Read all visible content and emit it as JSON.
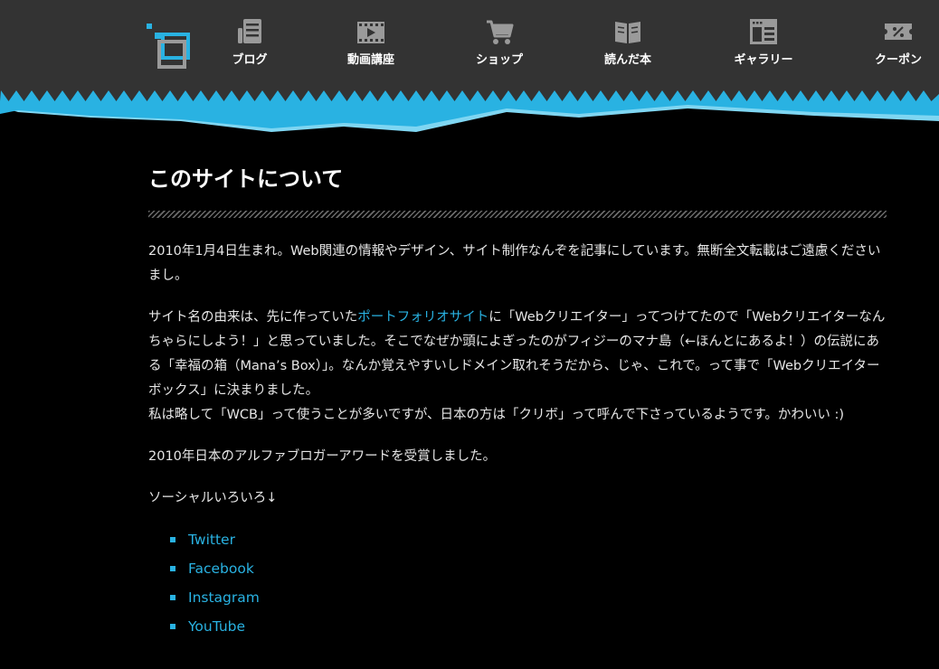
{
  "colors": {
    "header_bg": "#333333",
    "accent": "#29b2e2",
    "accent_light": "#7fd6f2",
    "text": "#e6e6e6",
    "background": "#000000"
  },
  "logo": {
    "icon": "site-logo-icon"
  },
  "nav": [
    {
      "label": "ブログ",
      "icon": "notepad-icon"
    },
    {
      "label": "動画講座",
      "icon": "film-icon"
    },
    {
      "label": "ショップ",
      "icon": "shopping-cart-icon"
    },
    {
      "label": "読んだ本",
      "icon": "open-book-icon"
    },
    {
      "label": "ギャラリー",
      "icon": "browser-window-icon"
    },
    {
      "label": "クーポン",
      "icon": "coupon-ticket-icon"
    }
  ],
  "page": {
    "title": "このサイトについて",
    "p1": "2010年1月4日生まれ。Web関連の情報やデザイン、サイト制作なんぞを記事にしています。無断全文転載はご遠慮くださいまし。",
    "p2_before": "サイト名の由来は、先に作っていた",
    "p2_link": "ポートフォリオサイト",
    "p2_after": "に「Webクリエイター」ってつけてたので「Webクリエイターなんちゃらにしよう！」と思っていました。そこでなぜか頭によぎったのがフィジーのマナ島（←ほんとにあるよ！）の伝説にある「幸福の箱（Mana’s Box）」。なんか覚えやすいしドメイン取れそうだから、じゃ、これで。って事で「Webクリエイターボックス」に決まりました。",
    "p2_line2": "私は略して「WCB」って使うことが多いですが、日本の方は「クリボ」って呼んで下さっているようです。かわいい :)",
    "p3": "2010年日本のアルファブロガーアワードを受賞しました。",
    "p4": "ソーシャルいろいろ↓",
    "social": [
      "Twitter",
      "Facebook",
      "Instagram",
      "YouTube"
    ]
  }
}
